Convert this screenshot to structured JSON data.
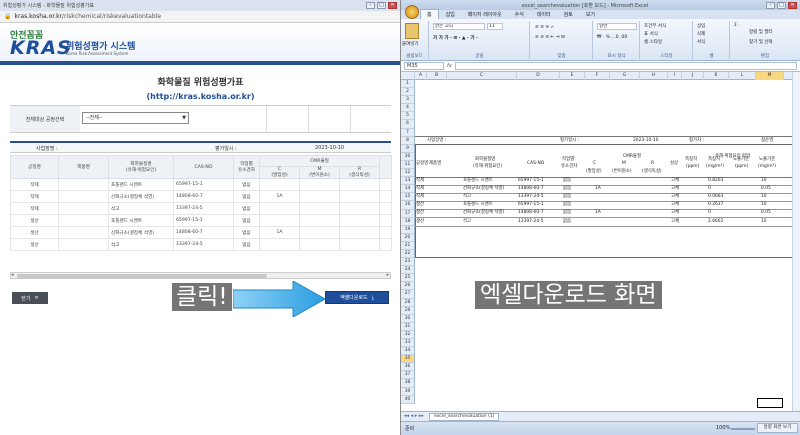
{
  "browser": {
    "tab_title": "위험성평가 시스템 - 화학물질 위험성평가표",
    "url_host": "kras.kosha.or.kr",
    "url_path": "/riskchemical/riskevaluationtable",
    "logo_top": "안전꼼꼼",
    "logo_main": "KRAS",
    "logo_korean": "위험성평가 시스템",
    "logo_english": "Korea Risk Assessment System"
  },
  "form": {
    "title": "화학물질 위험성평가표",
    "url": "(http://kras.kosha.or.kr)",
    "filter_label": "전체대상 공정선택",
    "filter_value": "--전체--",
    "info_company_label": "사업장명 :",
    "info_date_label": "평가일시 :",
    "info_date": "2023-10-10"
  },
  "table": {
    "headers": {
      "process": "공정명",
      "product": "제품명",
      "chemical": "화학물질명",
      "chemical_sub": "(유해·위험요인)",
      "cas": "CAS-NO",
      "worker": "작업별",
      "worker_sub": "유소견자",
      "cmr": "CMR물질",
      "c": "C",
      "c_sub": "(발암성)",
      "m": "M",
      "m_sub": "(변이원소)",
      "r": "R",
      "r_sub": "(생식독성)"
    },
    "rows": [
      {
        "process": "작제",
        "chemical": "포틀랜드 시멘트",
        "cas": "65997-15-1",
        "worker": "없음",
        "c": ""
      },
      {
        "process": "작제",
        "chemical": "산화규소(결정체 석영)",
        "cas": "14808-60-7",
        "worker": "없음",
        "c": "1A"
      },
      {
        "process": "작제",
        "chemical": "석고",
        "cas": "13397-24-5",
        "worker": "없음",
        "c": ""
      },
      {
        "process": "생산",
        "chemical": "포틀랜드 시멘트",
        "cas": "65997-15-1",
        "worker": "없음",
        "c": ""
      },
      {
        "process": "생산",
        "chemical": "산화규소(결정체 석영)",
        "cas": "14808-60-7",
        "worker": "없음",
        "c": "1A"
      },
      {
        "process": "생산",
        "chemical": "석고",
        "cas": "13397-24-5",
        "worker": "없음",
        "c": ""
      }
    ]
  },
  "buttons": {
    "close": "닫기",
    "close_icon": "✕",
    "excel": "엑셀다운로드",
    "excel_icon": "⤓"
  },
  "callouts": {
    "click": "클릭!",
    "excel_screen": "엑셀다운로드 화면"
  },
  "excel": {
    "title": "excel_searchevaluation [호환 모드] - Microsoft Excel",
    "tabs": [
      "홈",
      "삽입",
      "페이지 레이아웃",
      "수식",
      "데이터",
      "검토",
      "보기"
    ],
    "ribbon": {
      "paste": "붙여넣기",
      "clipboard": "클립보드",
      "font_name": "맑은 고딕",
      "font_size": "11",
      "font_group": "글꼴",
      "align_group": "맞춤",
      "number_format": "일반",
      "number_group": "표시 형식",
      "cond_format": "조건부 서식",
      "table_format": "표 서식",
      "cell_style": "셀 스타일",
      "style_group": "스타일",
      "insert": "삽입",
      "delete": "삭제",
      "format": "서식",
      "cells_group": "셀",
      "sort": "정렬 및 필터",
      "find": "찾기 및 선택",
      "edit_group": "편집"
    },
    "namebox": "M35",
    "fx": "fx",
    "columns": [
      "A",
      "B",
      "C",
      "D",
      "E",
      "F",
      "G",
      "H",
      "I",
      "J",
      "K",
      "L",
      "M"
    ],
    "rows_numbers": [
      "1",
      "2",
      "3",
      "4",
      "5",
      "6",
      "7",
      "8",
      "9",
      "10",
      "11",
      "12",
      "13",
      "14",
      "15",
      "16",
      "17",
      "18",
      "19",
      "20",
      "21",
      "22",
      "23",
      "24",
      "25",
      "26",
      "27",
      "28",
      "29",
      "30",
      "31",
      "32",
      "33",
      "34",
      "35",
      "36",
      "37",
      "38",
      "39",
      "40"
    ],
    "sheet": {
      "company_label": "사업장명 :",
      "date_label": "평가일시 :",
      "date": "2023-10-10",
      "evaluator_label": "평가자 :",
      "evaluator": "정운영",
      "risk_header": "유해·위험요인 파악",
      "h_process": "공정명",
      "h_product": "제품명",
      "h_chemical": "화학물질명",
      "h_chemical_sub": "(유해·위험요인)",
      "h_cas": "CAS-NO",
      "h_worker": "작업별",
      "h_worker_sub": "유소견자",
      "h_cmr": "CMR물질",
      "h_c": "C",
      "h_c_sub": "(발암성)",
      "h_m": "M",
      "h_m_sub": "(변이원소)",
      "h_r": "R",
      "h_r_sub": "(생식독성)",
      "h_state": "성상",
      "h_measure_ppm": "측정치",
      "h_measure_ppm_unit": "(ppm)",
      "h_measure_mg": "측정치",
      "h_measure_mg_unit": "(mg/m³)",
      "h_limit_ppm": "노출기준",
      "h_limit_ppm_unit": "(ppm)",
      "h_limit_mg": "노출기준",
      "h_limit_mg_unit": "(mg/m³)",
      "rows": [
        {
          "process": "작제",
          "chemical": "포틀랜드 시멘트",
          "cas": "65997-15-1",
          "worker": "없음",
          "c": "",
          "state": "고체",
          "mg": "0.8203",
          "lim_mg": "10"
        },
        {
          "process": "작제",
          "chemical": "산화규소(결정체 석영)",
          "cas": "14808-60-7",
          "worker": "없음",
          "c": "1A",
          "state": "고체",
          "mg": "0",
          "lim_mg": "0.05"
        },
        {
          "process": "작제",
          "chemical": "석고",
          "cas": "13397-24-5",
          "worker": "없음",
          "c": "",
          "state": "고체",
          "mg": "0.0663",
          "lim_mg": "10"
        },
        {
          "process": "생산",
          "chemical": "포틀랜드 시멘트",
          "cas": "65997-15-1",
          "worker": "없음",
          "c": "",
          "state": "고체",
          "mg": "0.2637",
          "lim_mg": "10"
        },
        {
          "process": "생산",
          "chemical": "산화규소(결정체 석영)",
          "cas": "14808-60-7",
          "worker": "없음",
          "c": "1A",
          "state": "고체",
          "mg": "0",
          "lim_mg": "0.05"
        },
        {
          "process": "생산",
          "chemical": "석고",
          "cas": "13397-24-5",
          "worker": "없음",
          "c": "",
          "state": "고체",
          "mg": "2.6602",
          "lim_mg": "10"
        }
      ]
    },
    "sheet_tab": "excel_searchevaluation (1)",
    "status": "준비",
    "zoom": "100%",
    "hint": "방향 화면 보기"
  }
}
